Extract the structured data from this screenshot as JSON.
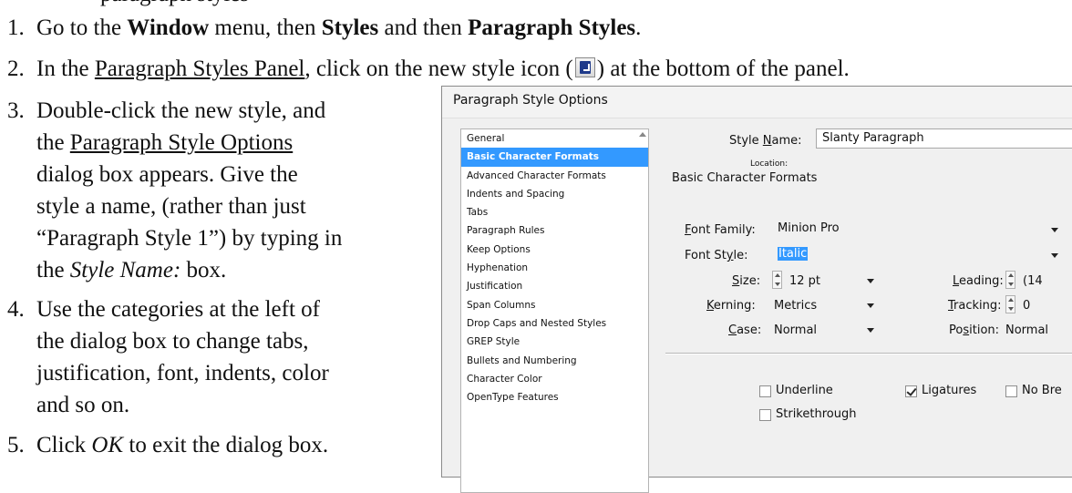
{
  "doc": {
    "top_fragment": "paragraph styles",
    "step1": {
      "num": "1.",
      "pre": "Go to the ",
      "b1": "Window",
      "mid1": " menu, then ",
      "b2": "Styles",
      "mid2": " and then ",
      "b3": "Paragraph Styles",
      "end": "."
    },
    "step2": {
      "num": "2.",
      "pre": "In the ",
      "link": "Paragraph Styles Panel",
      "mid": ", click on the new style icon (",
      "icon": "new-style-icon",
      "end": ") at the bottom of the panel."
    },
    "step3": {
      "num": "3.",
      "l1": "Double-click the new style, and",
      "l2": "the ",
      "l2_link": "Paragraph Style Options",
      "l3": "dialog box appears. Give the",
      "l4": "style a name, (rather than just",
      "l5": "“Paragraph Style 1”) by typing in",
      "l6_pre": "the ",
      "l6_i": "Style Name:",
      "l6_end": " box."
    },
    "step4": {
      "num": "4.",
      "l1": "Use the categories at the left of",
      "l2": "the dialog box to change tabs,",
      "l3": "justification, font, indents, color",
      "l4": "and so on."
    },
    "step5": {
      "num": "5.",
      "pre": "Click ",
      "i": "OK",
      "end": " to exit the dialog box."
    }
  },
  "dialog": {
    "title": "Paragraph Style Options",
    "categories": [
      "General",
      "Basic Character Formats",
      "Advanced Character Formats",
      "Indents and Spacing",
      "Tabs",
      "Paragraph Rules",
      "Keep Options",
      "Hyphenation",
      "Justification",
      "Span Columns",
      "Drop Caps and Nested Styles",
      "GREP Style",
      "Bullets and Numbering",
      "Character Color",
      "OpenType Features"
    ],
    "selected_category": "Basic Character Formats",
    "style_name_label": "Style Name:",
    "style_name_value": "Slanty Paragraph",
    "location_label": "Location:",
    "section_heading": "Basic Character Formats",
    "font_family_label": "Font Family:",
    "font_family_value": "Minion Pro",
    "font_style_label": "Font Style:",
    "font_style_value": "Italic",
    "size_label": "Size:",
    "size_value": "12 pt",
    "leading_label": "Leading:",
    "leading_value": "(14",
    "kerning_label": "Kerning:",
    "kerning_value": "Metrics",
    "tracking_label": "Tracking:",
    "tracking_value": "0",
    "case_label": "Case:",
    "case_value": "Normal",
    "position_label": "Position:",
    "position_value": "Normal",
    "underline_label": "Underline",
    "underline_checked": false,
    "ligatures_label": "Ligatures",
    "ligatures_checked": true,
    "nobreak_label": "No Bre",
    "nobreak_checked": false,
    "strikethrough_label": "Strikethrough",
    "strikethrough_checked": false
  }
}
